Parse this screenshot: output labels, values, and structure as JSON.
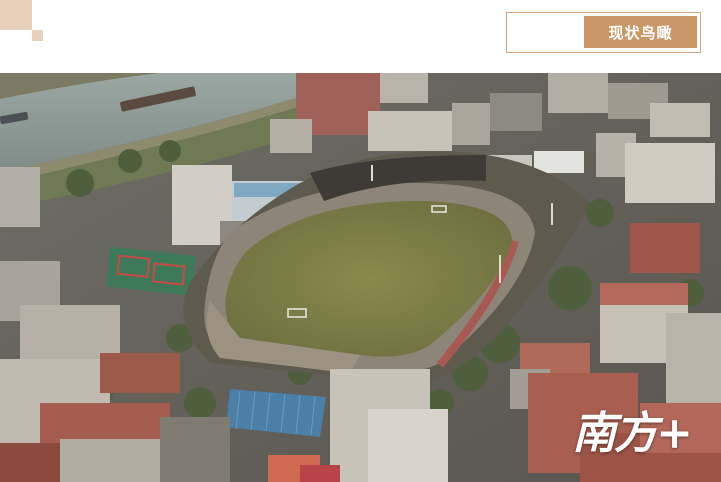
{
  "header": {
    "title": "现状鸟瞰",
    "accent_color": "#c99866",
    "frame_color": "#d4a57a",
    "decor_color": "#e9d2bd"
  },
  "photo": {
    "subject": "aerial-stadium-photo",
    "watermark": "南方+"
  }
}
